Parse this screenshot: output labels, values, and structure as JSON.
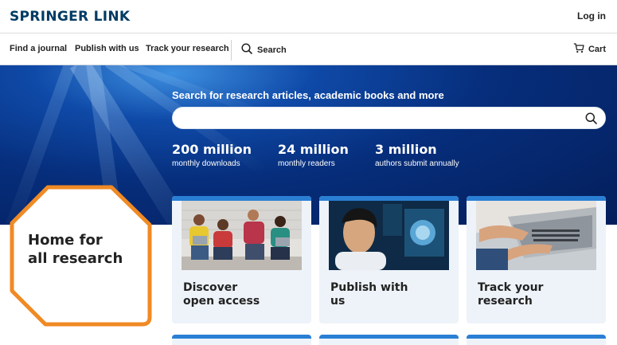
{
  "header": {
    "logo": "SPRINGER LINK",
    "login_label": "Log in"
  },
  "nav": {
    "items": [
      {
        "label": "Find a journal"
      },
      {
        "label": "Publish with us"
      },
      {
        "label": "Track your research"
      }
    ],
    "search_label": "Search",
    "cart_label": "Cart"
  },
  "hero": {
    "title": "Search for research articles, academic books and more",
    "search_placeholder": "",
    "stats": [
      {
        "value": "200 million",
        "label": "monthly downloads"
      },
      {
        "value": "24 million",
        "label": "monthly readers"
      },
      {
        "value": "3 million",
        "label": "authors submit annually"
      }
    ]
  },
  "badge": {
    "line1": "Home for",
    "line2": "all research"
  },
  "cards": [
    {
      "line1": "Discover",
      "line2": "open access"
    },
    {
      "line1": "Publish with",
      "line2": "us"
    },
    {
      "line1": "Track your",
      "line2": "research"
    }
  ],
  "colors": {
    "brand_navy": "#003b63",
    "accent_orange": "#f08a24",
    "card_blue": "#2a7fd4",
    "card_bg": "#eef3f9",
    "hero_blue": "#0b3c94"
  }
}
